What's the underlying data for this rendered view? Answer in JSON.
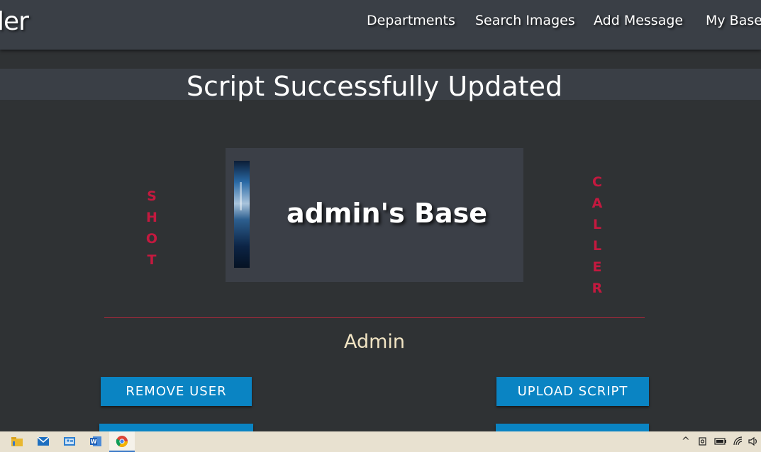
{
  "navbar": {
    "brand": "ler",
    "links": [
      "Departments",
      "Search Images",
      "Add Message",
      "My Base"
    ]
  },
  "page": {
    "title": "Script Successfully Updated"
  },
  "sidebars": {
    "left_word": [
      "S",
      "H",
      "O",
      "T"
    ],
    "right_word": [
      "C",
      "A",
      "L",
      "L",
      "E",
      "R"
    ]
  },
  "base": {
    "name": "admin's Base"
  },
  "role": "Admin",
  "buttons": {
    "remove_user": "REMOVE USER",
    "upload_script": "UPLOAD SCRIPT"
  },
  "taskbar": {
    "apps": [
      "file-explorer-icon",
      "mail-icon",
      "contacts-icon",
      "word-icon",
      "chrome-icon"
    ],
    "tray": {
      "chevron": "^"
    }
  },
  "colors": {
    "navbar": "#3a3f46",
    "background": "#2f3234",
    "accent_red": "#c4193f",
    "button_blue": "#0a84c3",
    "role_text": "#f1e4c3"
  }
}
